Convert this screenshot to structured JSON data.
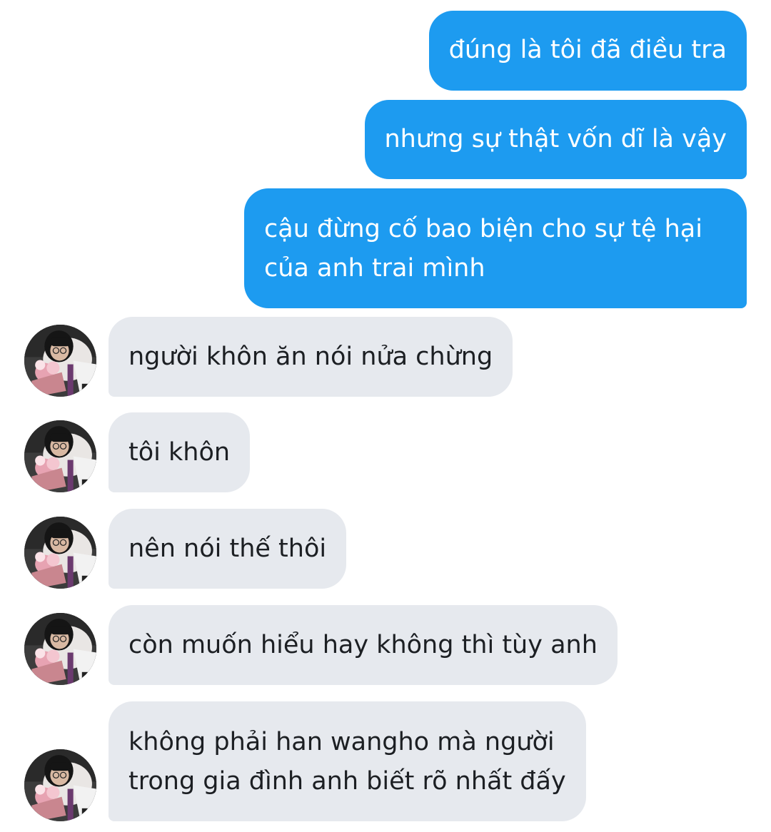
{
  "colors": {
    "sent_bubble": "#1d9bf0",
    "received_bubble": "#e6e9ee",
    "sent_text": "#ffffff",
    "received_text": "#1c1f23"
  },
  "conversation": {
    "outgoing": [
      {
        "text": "đúng là tôi đã điều tra"
      },
      {
        "text": "nhưng sự thật vốn dĩ là vậy"
      },
      {
        "lines": [
          "cậu đừng cố bao biện cho sự tệ hại",
          "của anh trai mình"
        ]
      }
    ],
    "incoming": [
      {
        "text": "người khôn ăn nói nửa chừng",
        "avatar": "contact-avatar"
      },
      {
        "text": "tôi khôn",
        "avatar": "contact-avatar"
      },
      {
        "text": "nên nói thế thôi",
        "avatar": "contact-avatar"
      },
      {
        "text": "còn muốn hiểu hay không thì tùy anh",
        "avatar": "contact-avatar"
      },
      {
        "lines": [
          "không phải han wangho mà người",
          "trong gia đình anh biết rõ nhất đấy"
        ],
        "avatar": "contact-avatar"
      }
    ]
  }
}
